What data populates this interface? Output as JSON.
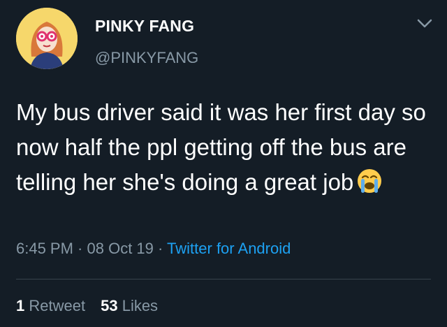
{
  "user": {
    "display_name": "PINKY FANG",
    "handle": "@PINKYFANG",
    "avatar_icon": "avatar-illustration"
  },
  "tweet": {
    "text": "My bus driver said it was her first day so now half the ppl getting off the bus are telling her she's doing a great job",
    "emoji": "loudly-crying-face-icon"
  },
  "meta": {
    "time": "6:45 PM",
    "sep1": " · ",
    "date": "08 Oct 19",
    "sep2": " · ",
    "source": "Twitter for Android"
  },
  "stats": {
    "retweets_count": "1",
    "retweets_label": "Retweet",
    "likes_count": "53",
    "likes_label": "Likes"
  },
  "colors": {
    "background": "#141d26",
    "muted": "#8899a6",
    "link": "#1da1f2"
  }
}
